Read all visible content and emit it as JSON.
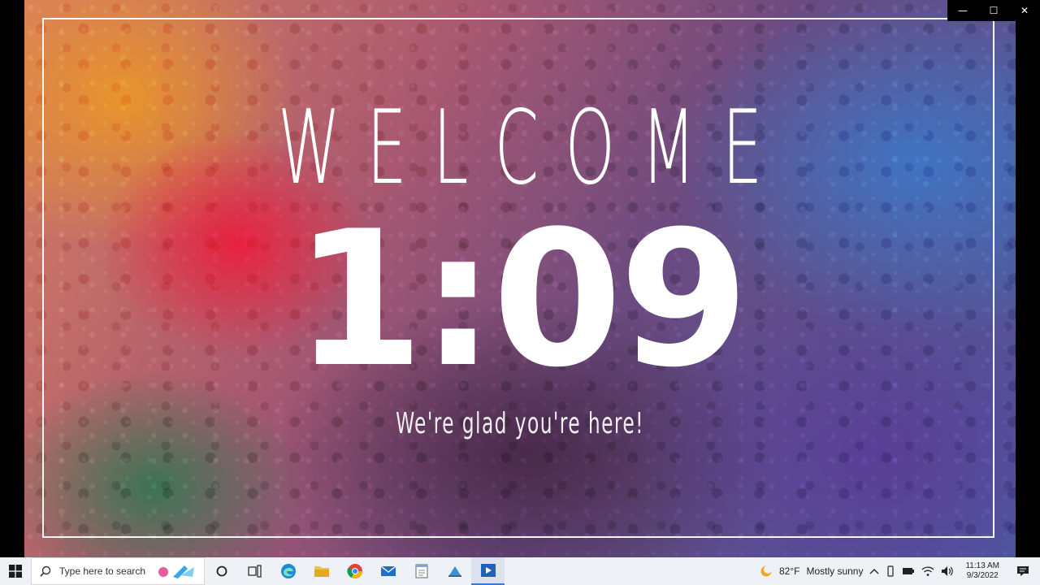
{
  "slide": {
    "title": "WELCOME",
    "countdown": "1:09",
    "tagline": "We're glad you're here!"
  },
  "window_controls": {
    "minimize": "—",
    "maximize": "☐",
    "close": "✕"
  },
  "taskbar": {
    "search_placeholder": "Type here to search",
    "apps": [
      "cortana-icon",
      "task-view-icon",
      "edge-icon",
      "file-explorer-icon",
      "chrome-icon",
      "mail-icon",
      "notepad-icon",
      "screen-capture-icon",
      "media-player-icon"
    ],
    "weather": {
      "temperature": "82°F",
      "condition": "Mostly sunny"
    },
    "clock": {
      "time": "11:13 AM",
      "date": "9/3/2022"
    }
  },
  "colors": {
    "accent": "#3b78d8",
    "taskbar_bg": "#eef1f5"
  }
}
